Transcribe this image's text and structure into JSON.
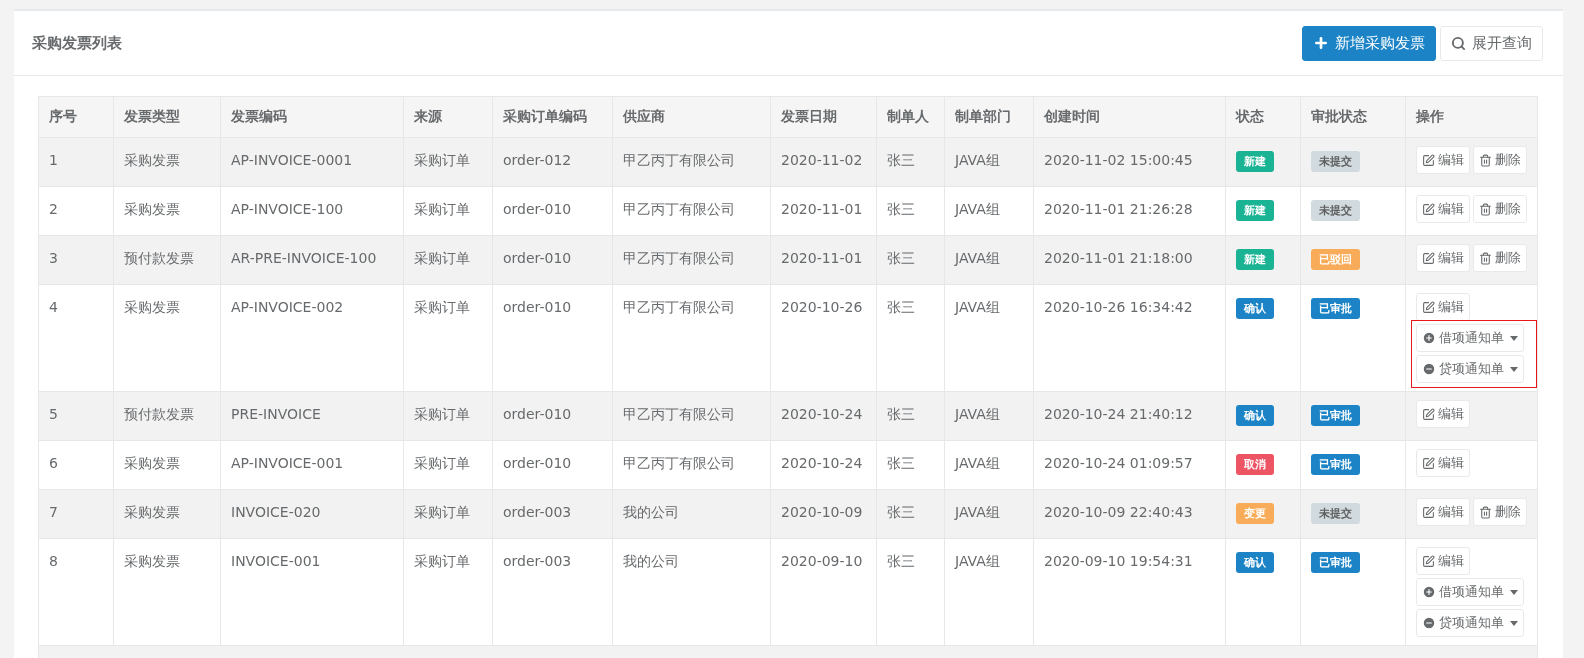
{
  "panel": {
    "title": "采购发票列表",
    "buttons": [
      {
        "kind": "add",
        "label": "新增采购发票"
      },
      {
        "kind": "search",
        "label": "展开查询"
      }
    ]
  },
  "table": {
    "columns": [
      "序号",
      "发票类型",
      "发票编码",
      "来源",
      "采购订单编码",
      "供应商",
      "发票日期",
      "制单人",
      "制单部门",
      "创建时间",
      "状态",
      "审批状态",
      "操作"
    ],
    "rows": [
      {
        "cells": [
          "1",
          "采购发票",
          "AP-INVOICE-0001",
          "采购订单",
          "order-012",
          "甲乙丙丁有限公司",
          "2020-11-02",
          "张三",
          "JAVA组",
          "2020-11-02 15:00:45"
        ],
        "status": {
          "label": "新建",
          "color": "#1ab394"
        },
        "approval": {
          "label": "未提交",
          "color": "#d1dade"
        },
        "highlighted": false,
        "actions": [
          {
            "kind": "edit",
            "label": "编辑"
          },
          {
            "kind": "delete",
            "label": "删除"
          }
        ]
      },
      {
        "cells": [
          "2",
          "采购发票",
          "AP-INVOICE-100",
          "采购订单",
          "order-010",
          "甲乙丙丁有限公司",
          "2020-11-01",
          "张三",
          "JAVA组",
          "2020-11-01 21:26:28"
        ],
        "status": {
          "label": "新建",
          "color": "#1ab394"
        },
        "approval": {
          "label": "未提交",
          "color": "#d1dade"
        },
        "highlighted": false,
        "actions": [
          {
            "kind": "edit",
            "label": "编辑"
          },
          {
            "kind": "delete",
            "label": "删除"
          }
        ]
      },
      {
        "cells": [
          "3",
          "预付款发票",
          "AR-PRE-INVOICE-100",
          "采购订单",
          "order-010",
          "甲乙丙丁有限公司",
          "2020-11-01",
          "张三",
          "JAVA组",
          "2020-11-01 21:18:00"
        ],
        "status": {
          "label": "新建",
          "color": "#1ab394"
        },
        "approval": {
          "label": "已驳回",
          "color": "#f8ac59"
        },
        "highlighted": false,
        "actions": [
          {
            "kind": "edit",
            "label": "编辑"
          },
          {
            "kind": "delete",
            "label": "删除"
          }
        ]
      },
      {
        "cells": [
          "4",
          "采购发票",
          "AP-INVOICE-002",
          "采购订单",
          "order-010",
          "甲乙丙丁有限公司",
          "2020-10-26",
          "张三",
          "JAVA组",
          "2020-10-26 16:34:42"
        ],
        "status": {
          "label": "确认",
          "color": "#1c84c6"
        },
        "approval": {
          "label": "已审批",
          "color": "#1c84c6"
        },
        "highlighted": true,
        "actions": [
          {
            "kind": "edit",
            "label": "编辑"
          },
          {
            "kind": "debit",
            "label": "借项通知单"
          },
          {
            "kind": "credit",
            "label": "贷项通知单"
          }
        ]
      },
      {
        "cells": [
          "5",
          "预付款发票",
          "PRE-INVOICE",
          "采购订单",
          "order-010",
          "甲乙丙丁有限公司",
          "2020-10-24",
          "张三",
          "JAVA组",
          "2020-10-24 21:40:12"
        ],
        "status": {
          "label": "确认",
          "color": "#1c84c6"
        },
        "approval": {
          "label": "已审批",
          "color": "#1c84c6"
        },
        "highlighted": false,
        "actions": [
          {
            "kind": "edit",
            "label": "编辑"
          }
        ]
      },
      {
        "cells": [
          "6",
          "采购发票",
          "AP-INVOICE-001",
          "采购订单",
          "order-010",
          "甲乙丙丁有限公司",
          "2020-10-24",
          "张三",
          "JAVA组",
          "2020-10-24 01:09:57"
        ],
        "status": {
          "label": "取消",
          "color": "#ed5565"
        },
        "approval": {
          "label": "已审批",
          "color": "#1c84c6"
        },
        "highlighted": false,
        "actions": [
          {
            "kind": "edit",
            "label": "编辑"
          }
        ]
      },
      {
        "cells": [
          "7",
          "采购发票",
          "INVOICE-020",
          "采购订单",
          "order-003",
          "我的公司",
          "2020-10-09",
          "张三",
          "JAVA组",
          "2020-10-09 22:40:43"
        ],
        "status": {
          "label": "变更",
          "color": "#f8ac59"
        },
        "approval": {
          "label": "未提交",
          "color": "#d1dade"
        },
        "highlighted": false,
        "actions": [
          {
            "kind": "edit",
            "label": "编辑"
          },
          {
            "kind": "delete",
            "label": "删除"
          }
        ]
      },
      {
        "cells": [
          "8",
          "采购发票",
          "INVOICE-001",
          "采购订单",
          "order-003",
          "我的公司",
          "2020-09-10",
          "张三",
          "JAVA组",
          "2020-09-10 19:54:31"
        ],
        "status": {
          "label": "确认",
          "color": "#1c84c6"
        },
        "approval": {
          "label": "已审批",
          "color": "#1c84c6"
        },
        "highlighted": false,
        "actions": [
          {
            "kind": "edit",
            "label": "编辑"
          },
          {
            "kind": "debit",
            "label": "借项通知单"
          },
          {
            "kind": "credit",
            "label": "贷项通知单"
          }
        ]
      }
    ]
  }
}
